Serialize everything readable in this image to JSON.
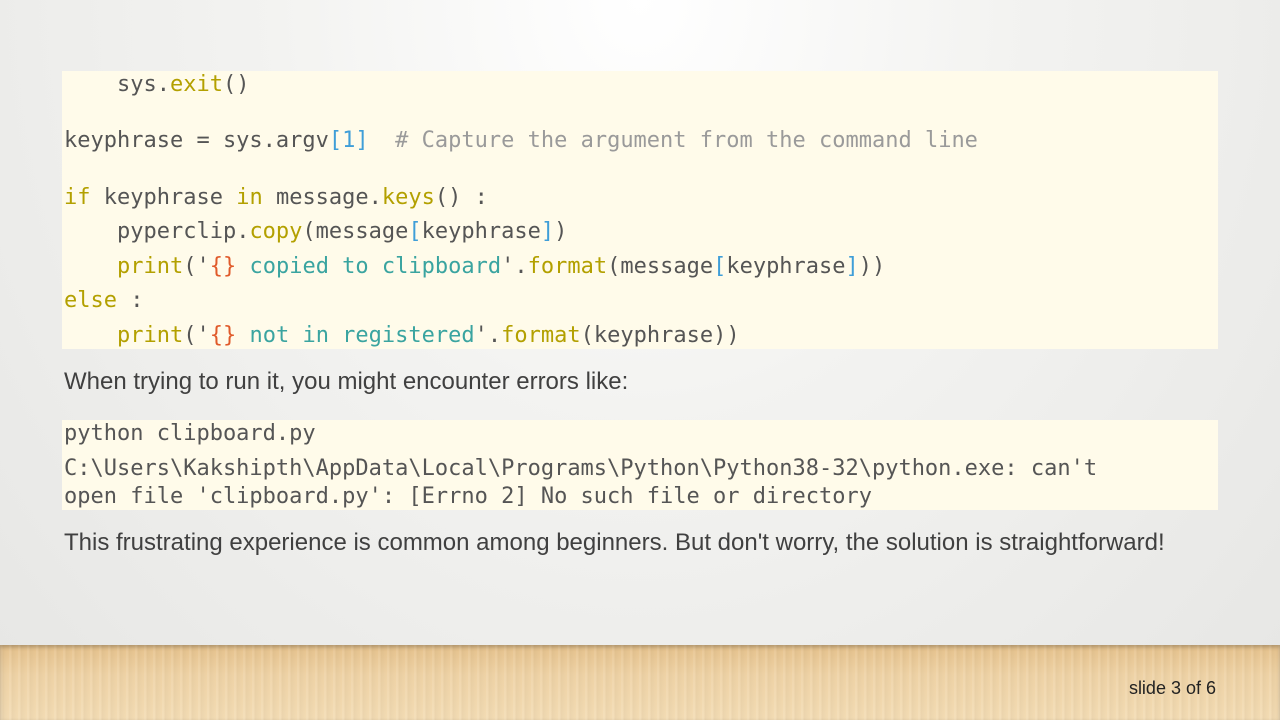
{
  "code_block_1": {
    "lines": [
      {
        "indent": "    ",
        "parts": [
          {
            "t": "sys.",
            "c": "plain"
          },
          {
            "t": "exit",
            "c": "fn"
          },
          {
            "t": "()",
            "c": "plain"
          }
        ]
      },
      {
        "indent": "",
        "parts": [
          {
            "t": "keyphrase = sys.argv",
            "c": "plain"
          },
          {
            "t": "[",
            "c": "br"
          },
          {
            "t": "1",
            "c": "num"
          },
          {
            "t": "]",
            "c": "br"
          },
          {
            "t": "  # Capture the argument from the command line",
            "c": "cm"
          }
        ]
      },
      {
        "indent": "",
        "parts": [
          {
            "t": "if",
            "c": "kw"
          },
          {
            "t": " keyphrase ",
            "c": "plain"
          },
          {
            "t": "in",
            "c": "kw"
          },
          {
            "t": " message.",
            "c": "plain"
          },
          {
            "t": "keys",
            "c": "fn"
          },
          {
            "t": "() :",
            "c": "plain"
          }
        ]
      },
      {
        "indent": "    ",
        "parts": [
          {
            "t": "pyperclip.",
            "c": "plain"
          },
          {
            "t": "copy",
            "c": "fn"
          },
          {
            "t": "(message",
            "c": "plain"
          },
          {
            "t": "[",
            "c": "br"
          },
          {
            "t": "keyphrase",
            "c": "plain"
          },
          {
            "t": "]",
            "c": "br"
          },
          {
            "t": ")",
            "c": "plain"
          }
        ]
      },
      {
        "indent": "    ",
        "parts": [
          {
            "t": "print",
            "c": "fn"
          },
          {
            "t": "('",
            "c": "plain"
          },
          {
            "t": "{}",
            "c": "esc"
          },
          {
            "t": " copied to clipboard",
            "c": "str"
          },
          {
            "t": "'.",
            "c": "plain"
          },
          {
            "t": "format",
            "c": "fn"
          },
          {
            "t": "(message",
            "c": "plain"
          },
          {
            "t": "[",
            "c": "br"
          },
          {
            "t": "keyphrase",
            "c": "plain"
          },
          {
            "t": "]",
            "c": "br"
          },
          {
            "t": "))",
            "c": "plain"
          }
        ]
      },
      {
        "indent": "",
        "parts": [
          {
            "t": "else",
            "c": "kw"
          },
          {
            "t": " :",
            "c": "plain"
          }
        ]
      },
      {
        "indent": "    ",
        "parts": [
          {
            "t": "print",
            "c": "fn"
          },
          {
            "t": "('",
            "c": "plain"
          },
          {
            "t": "{}",
            "c": "esc"
          },
          {
            "t": " not in registered",
            "c": "str"
          },
          {
            "t": "'.",
            "c": "plain"
          },
          {
            "t": "format",
            "c": "fn"
          },
          {
            "t": "(keyphrase))",
            "c": "plain"
          }
        ]
      }
    ]
  },
  "paragraph_1": "When trying to run it, you might encounter errors like:",
  "code_block_2": {
    "command": "python clipboard.py",
    "error_line_1": "C:\\Users\\Kakshipth\\AppData\\Local\\Programs\\Python\\Python38-32\\python.exe: can't",
    "error_line_2": "open file 'clipboard.py': [Errno 2] No such file or directory"
  },
  "paragraph_2": "This frustrating experience is common among beginners. But don't worry, the solution is straightforward!",
  "footer": {
    "slide_counter": "slide 3 of 6"
  },
  "colors": {
    "code_background": "#fffbea",
    "keyword": "#b3a000",
    "bracket": "#3f9ed8",
    "string": "#3aa4a0",
    "format_placeholder": "#e05a2a",
    "comment": "#9a9a9a",
    "text": "#404040"
  }
}
